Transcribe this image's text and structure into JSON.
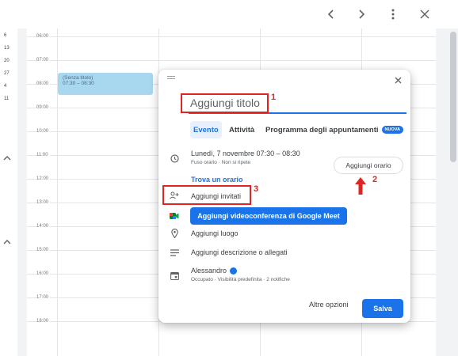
{
  "toolbar": {
    "icons": [
      "chevron-left-icon",
      "chevron-right-icon",
      "more-vert-icon",
      "close-icon"
    ]
  },
  "mini_calendar_numbers": [
    "6",
    "13",
    "20",
    "27",
    "4",
    "11"
  ],
  "hours": [
    "06:00",
    "07:00",
    "08:00",
    "09:00",
    "10:00",
    "11:00",
    "12:00",
    "13:00",
    "14:00",
    "15:00",
    "16:00",
    "17:00",
    "18:00"
  ],
  "event_chip": {
    "title": "(Senza titolo)",
    "time": "07:30 – 08:30",
    "color": "#a8d8f0"
  },
  "dialog": {
    "title_placeholder": "Aggiungi titolo",
    "tabs": [
      {
        "label": "Evento",
        "active": true
      },
      {
        "label": "Attività",
        "active": false
      },
      {
        "label": "Programma degli appuntamenti",
        "active": false,
        "badge": "NUOVA"
      }
    ],
    "datetime": "Lunedì, 7 novembre   07:30  –  08:30",
    "timezone_note": "Fuso orario · Non si ripete",
    "find_time_link": "Trova un orario",
    "add_time_button": "Aggiungi orario",
    "guests": "Aggiungi invitati",
    "meet_button": "Aggiungi videoconferenza di Google Meet",
    "location": "Aggiungi luogo",
    "description": "Aggiungi descrizione o allegati",
    "calendar_owner": "Alessandro",
    "calendar_details": "Occupato · Visibilità predefinita · 2 notifiche",
    "more_options": "Altre opzioni",
    "save": "Salva"
  },
  "annotations": [
    "1",
    "2",
    "3"
  ],
  "colors": {
    "accent": "#1a73e8",
    "annotation": "#e02424"
  }
}
